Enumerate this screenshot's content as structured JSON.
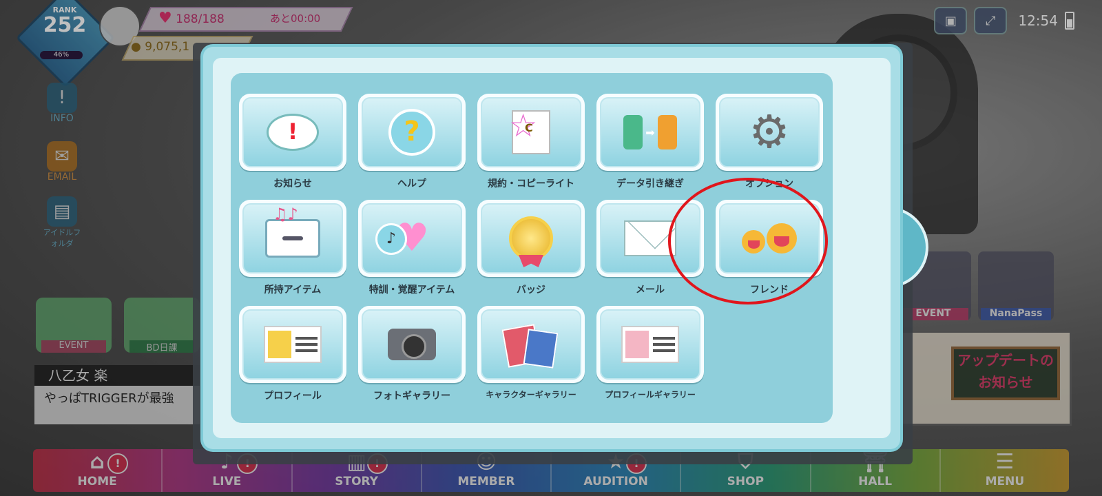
{
  "hud": {
    "rank_label": "RANK",
    "rank_value": "252",
    "rank_progress": "46%",
    "stamina": "188/188",
    "stamina_timer": "あと00:00",
    "coins": "9,075,1",
    "clock": "12:54"
  },
  "side_buttons": [
    "INFO",
    "EMAIL",
    "アイドルフォルダ"
  ],
  "left_cards": [
    "EVENT",
    "BD日課"
  ],
  "character": {
    "name": "八乙女 楽",
    "line": "やっぱTRIGGERが最強"
  },
  "promos": [
    "EVENT",
    "NanaPass"
  ],
  "update_banner": "アップデートのお知らせ",
  "menu": {
    "tiles": [
      {
        "label": "お知らせ",
        "icon": "notice-bubble-icon"
      },
      {
        "label": "ヘルプ",
        "icon": "help-icon"
      },
      {
        "label": "規約・コピーライト",
        "icon": "terms-icon"
      },
      {
        "label": "データ引き継ぎ",
        "icon": "data-transfer-icon"
      },
      {
        "label": "オプション",
        "icon": "gear-icon"
      },
      {
        "label": "所持アイテム",
        "icon": "item-box-icon"
      },
      {
        "label": "特訓・覚醒アイテム",
        "icon": "training-item-icon"
      },
      {
        "label": "バッジ",
        "icon": "badge-icon"
      },
      {
        "label": "メール",
        "icon": "mail-icon"
      },
      {
        "label": "フレンド",
        "icon": "friends-icon"
      },
      {
        "label": "プロフィール",
        "icon": "profile-card-icon"
      },
      {
        "label": "フォトギャラリー",
        "icon": "camera-icon"
      },
      {
        "label": "キャラクターギャラリー",
        "icon": "character-gallery-icon"
      },
      {
        "label": "プロフィールギャラリー",
        "icon": "profile-gallery-icon"
      }
    ],
    "close": "✕"
  },
  "bottom_nav": [
    {
      "label": "HOME",
      "icon": "home-icon",
      "badge": true
    },
    {
      "label": "LIVE",
      "icon": "live-icon",
      "badge": true
    },
    {
      "label": "STORY",
      "icon": "story-icon",
      "badge": true
    },
    {
      "label": "MEMBER",
      "icon": "member-icon",
      "badge": false
    },
    {
      "label": "AUDITION",
      "icon": "audition-icon",
      "badge": true
    },
    {
      "label": "SHOP",
      "icon": "shop-icon",
      "badge": false
    },
    {
      "label": "HALL",
      "icon": "hall-icon",
      "badge": false
    },
    {
      "label": "MENU",
      "icon": "menu-icon",
      "badge": false
    }
  ],
  "colors": {
    "highlight_circle": "#e0161c",
    "modal_bg": "#a8dde6",
    "panel_bg": "#8fcfdb"
  }
}
